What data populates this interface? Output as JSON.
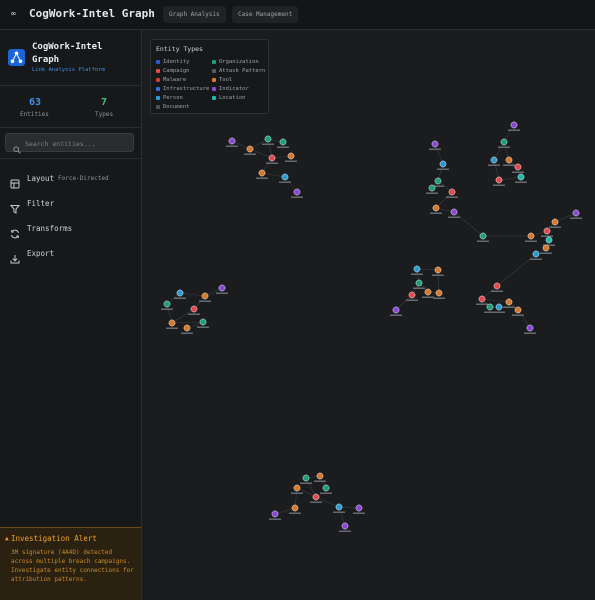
{
  "app": {
    "icon": "link-icon",
    "title": "CogWork-Intel Graph",
    "tabs": [
      "Graph Analysis",
      "Case Management"
    ]
  },
  "sidebar": {
    "brand_name": "CogWork-Intel Graph",
    "brand_subtitle": "Link Analysis Platform",
    "stats": [
      {
        "value": "63",
        "label": "Entities",
        "color": "#3f93f0"
      },
      {
        "value": "7",
        "label": "Types",
        "color": "#33c980"
      }
    ],
    "search_placeholder": "Search entities...",
    "nav": [
      {
        "icon": "layout-icon",
        "label": "Layout",
        "value": "Force-Directed"
      },
      {
        "icon": "filter-icon",
        "label": "Filter"
      },
      {
        "icon": "refresh-icon",
        "label": "Transforms"
      },
      {
        "icon": "download-icon",
        "label": "Export"
      }
    ],
    "alert": {
      "icon": "warning-icon",
      "title": "Investigation Alert",
      "body": "3M signature (4A4D) detected across multiple breach campaigns. Investigate entity connections for attribution patterns."
    }
  },
  "legend": {
    "title": "Entity Types",
    "items": [
      {
        "label": "Identity",
        "color": "#3159c9"
      },
      {
        "label": "Organization",
        "color": "#1e9e7b"
      },
      {
        "label": "Campaign",
        "color": "#e24b4b"
      },
      {
        "label": "Attack Pattern",
        "color": "#555a61"
      },
      {
        "label": "Malware",
        "color": "#cc3a3a"
      },
      {
        "label": "Tool",
        "color": "#d8782b"
      },
      {
        "label": "Infrastructure",
        "color": "#3c69d6"
      },
      {
        "label": "Indicator",
        "color": "#8b47d6"
      },
      {
        "label": "Person",
        "color": "#2a9cd0"
      },
      {
        "label": "Location",
        "color": "#1fb8aa"
      },
      {
        "label": "Document",
        "color": "#4d5259"
      }
    ]
  },
  "graph": {
    "colors": {
      "identity": "#3159c9",
      "organization": "#1e9e7b",
      "campaign": "#e24b4b",
      "malware": "#cc3a3a",
      "tool": "#d8782b",
      "infrastructure": "#3c69d6",
      "indicator": "#8b47d6",
      "person": "#2a9cd0",
      "location": "#1fb8aa",
      "document": "#4d5259"
    }
  }
}
